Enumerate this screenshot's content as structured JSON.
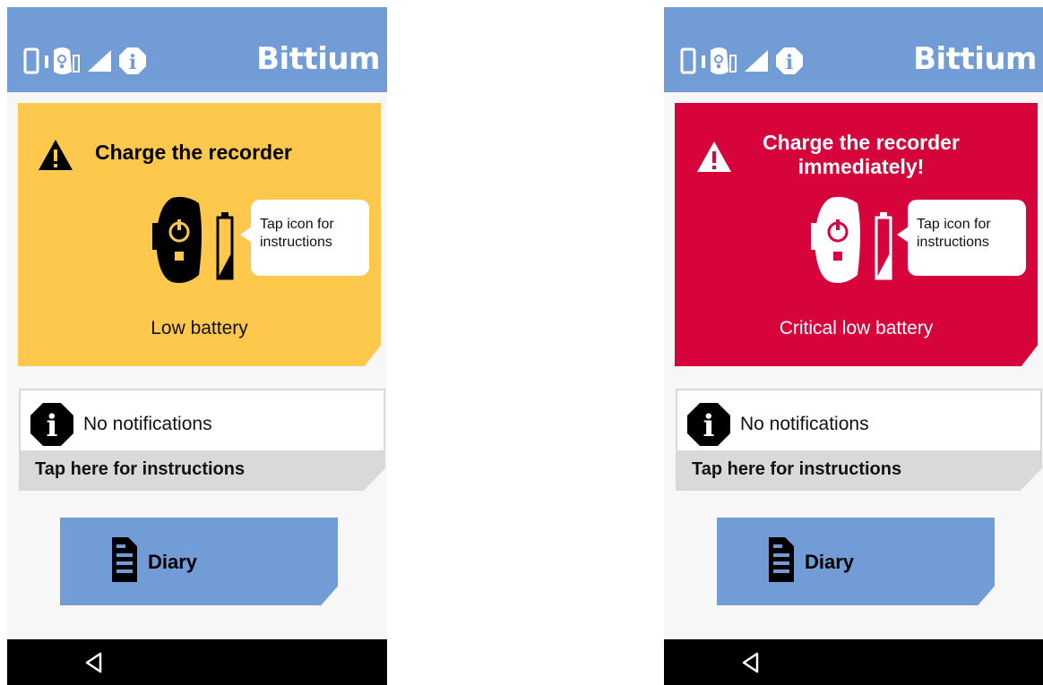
{
  "screens": [
    {
      "variant": "low",
      "brand": "Bittium",
      "alert": {
        "title": "Charge the recorder",
        "bubble": "Tap icon for instructions",
        "status": "Low battery",
        "color": "#fec84d"
      },
      "notification": {
        "text": "No notifications",
        "link": "Tap here for instructions"
      },
      "diary": {
        "label": "Diary"
      }
    },
    {
      "variant": "critical",
      "brand": "Bittium",
      "alert": {
        "title": "Charge the recorder immediately!",
        "bubble": "Tap icon for instructions",
        "status": "Critical low battery",
        "color": "#d6043a"
      },
      "notification": {
        "text": "No notifications",
        "link": "Tap here for instructions"
      },
      "diary": {
        "label": "Diary"
      }
    }
  ],
  "colors": {
    "header": "#729cd6",
    "background": "#f7f7f7",
    "navbar": "#000000"
  },
  "icons": {
    "status": [
      "phone-icon",
      "recorder-icon",
      "signal-icon",
      "info-icon"
    ],
    "alert": [
      "warning-icon",
      "recorder-battery-icon"
    ],
    "notification": "info-octagon-icon",
    "diary": "document-icon",
    "nav": "back-icon"
  }
}
